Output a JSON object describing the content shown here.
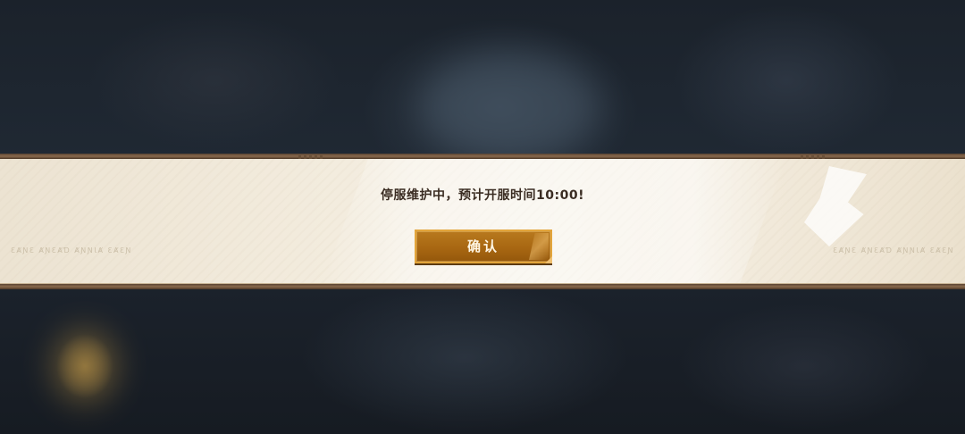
{
  "dialog": {
    "message": "停服维护中，预计开服时间10:00!",
    "confirm_label": "确认",
    "side_text_left": "ƐȺƝƐ ȺƝƐȺƊ ȺƝƝƖȺ ƐȺƐƝ",
    "side_text_right": "ƐȺƝƐ ȺƝƐȺƊ ȺƝƝƖȺ ƐȺƐƝ"
  },
  "colors": {
    "banner_bg": "#f3ecde",
    "button_fill": "#a86712",
    "button_border": "#e3a53b",
    "message_text": "#3a2c22"
  }
}
